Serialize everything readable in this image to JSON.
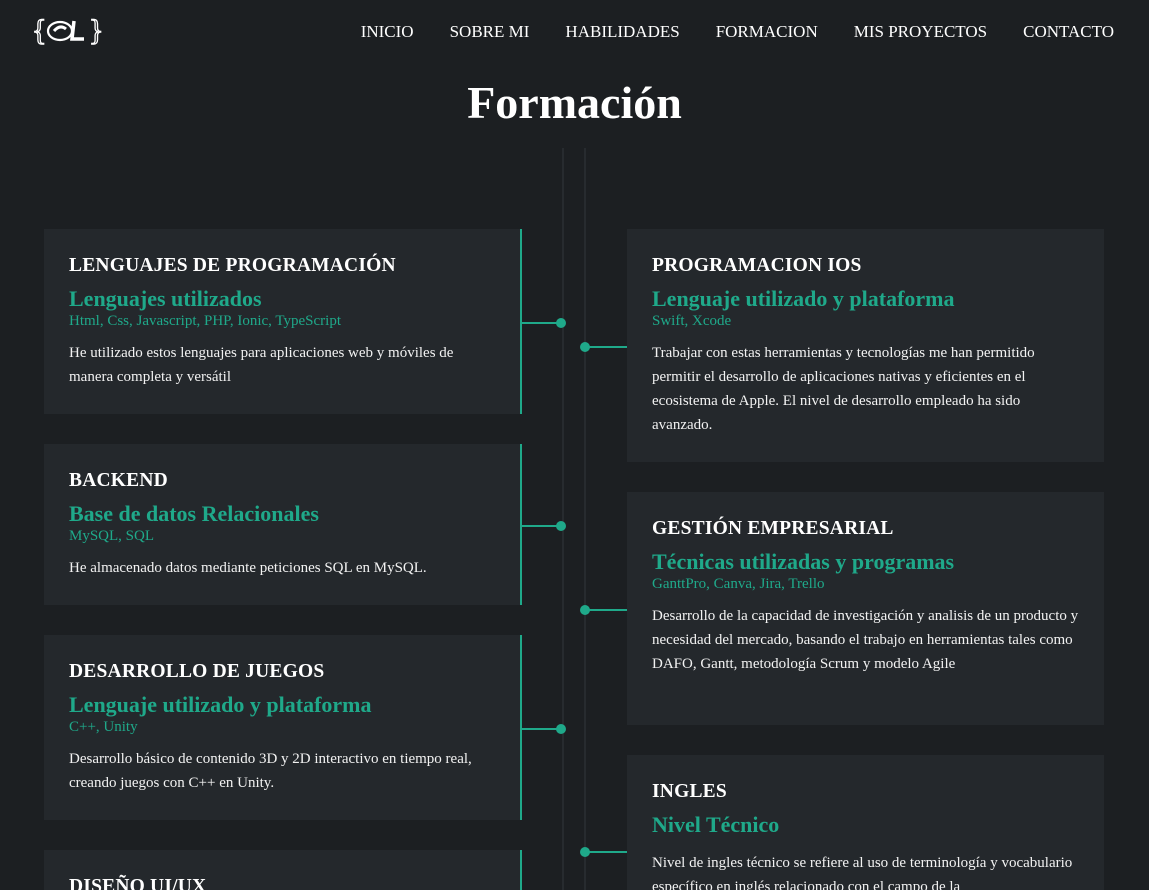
{
  "header": {
    "logo_text": "{CL}",
    "nav": [
      "INICIO",
      "SOBRE MI",
      "HABILIDADES",
      "FORMACION",
      "MIS PROYECTOS",
      "CONTACTO"
    ]
  },
  "page_title": "Formación",
  "accent_color": "#1fa98a",
  "cards_left": [
    {
      "title": "LENGUAJES DE PROGRAMACIÓN",
      "subtitle": "Lenguajes utilizados",
      "tech": "Html, Css, Javascript, PHP, Ionic, TypeScript",
      "text": "He utilizado estos lenguajes para aplicaciones web y móviles de manera completa y versátil"
    },
    {
      "title": "BACKEND",
      "subtitle": "Base de datos Relacionales",
      "tech": "MySQL, SQL",
      "text": "He almacenado datos mediante peticiones SQL en MySQL."
    },
    {
      "title": "DESARROLLO DE JUEGOS",
      "subtitle": "Lenguaje utilizado y plataforma",
      "tech": "C++, Unity",
      "text": "Desarrollo básico de contenido 3D y 2D interactivo en tiempo real, creando juegos con C++ en Unity."
    },
    {
      "title": "DISEÑO UI/UX",
      "subtitle": "",
      "tech": "",
      "text": ""
    }
  ],
  "cards_right": [
    {
      "title": "PROGRAMACION IOS",
      "subtitle": "Lenguaje utilizado y plataforma",
      "tech": "Swift, Xcode",
      "text": "Trabajar con estas herramientas y tecnologías me han permitido permitir el desarrollo de aplicaciones nativas y eficientes en el ecosistema de Apple. El nivel de desarrollo empleado ha sido avanzado."
    },
    {
      "title": "GESTIÓN EMPRESARIAL",
      "subtitle": "Técnicas utilizadas y programas",
      "tech": "GanttPro, Canva, Jira, Trello",
      "text": "Desarrollo de la capacidad de investigación y analisis de un producto y necesidad del mercado, basando el trabajo en herramientas tales como DAFO, Gantt, metodología Scrum y modelo Agile"
    },
    {
      "title": "INGLES",
      "subtitle": "Nivel Técnico",
      "tech": "",
      "text": "Nivel de ingles técnico se refiere al uso de terminología y vocabulario específico en inglés relacionado con el campo de la"
    }
  ]
}
